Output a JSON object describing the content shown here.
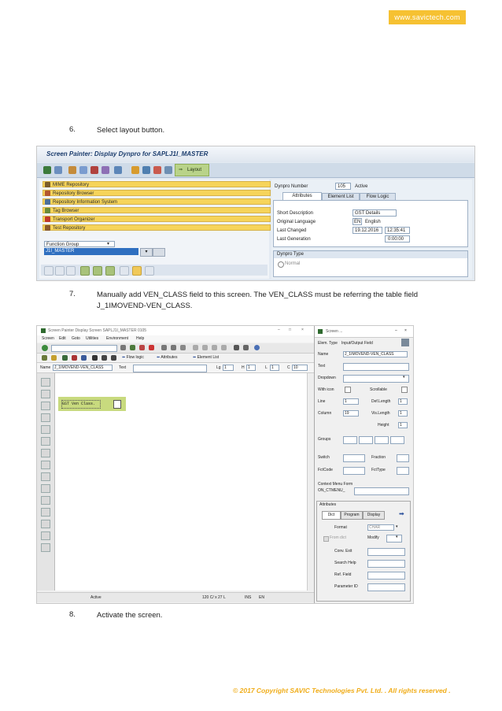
{
  "header": {
    "website": "www.savictech.com"
  },
  "steps": [
    {
      "num": "6.",
      "text": "Select layout button."
    },
    {
      "num": "7.",
      "text": "Manually add VEN_CLASS field to this screen. The VEN_CLASS must be referring the table field J_1IMOVEND-VEN_CLASS."
    },
    {
      "num": "8.",
      "text": "Activate the screen."
    }
  ],
  "shot1": {
    "title": "Screen Painter: Display Dynpro for SAPLJ1I_MASTER",
    "layout_btn": "Layout",
    "nav_items": [
      "MIME Repository",
      "Repository Browser",
      "Repository Information System",
      "Tag Browser",
      "Transport Organizer",
      "Test Repository"
    ],
    "object_type": "Function Group",
    "object_name": "J1I_MASTER",
    "dynpro_label": "Dynpro Number",
    "dynpro_number": "105",
    "dynpro_status": "Active",
    "tabs": [
      "Attributes",
      "Element List",
      "Flow Logic"
    ],
    "attr_labels": [
      "Short Description",
      "Original Language",
      "Last Changed",
      "Last Generation"
    ],
    "short_desc": "GST Details",
    "lang_code": "EN",
    "lang_name": "English",
    "last_changed_date": "19.12.2016",
    "last_changed_time": "12:35:41",
    "last_gen_time": "0:00:00",
    "dynpro_type_label": "Dynpro Type",
    "normal_label": "Normal"
  },
  "shot2": {
    "title": "Screen Painter   Display Screen SAPLJ1I_MASTER 0105",
    "menu": [
      "Screen",
      "Edit",
      "Goto",
      "Utilities",
      "Environment",
      "Help"
    ],
    "app_toolbar": [
      "Flow logic",
      "Attributes",
      "Element List"
    ],
    "name_label": "Name",
    "name_value": "J_1IMOVEND-VEN_CLASS",
    "text_label": "Text",
    "lg_label": "Lg",
    "lg_value": "1",
    "h_label": "H",
    "h_value": "1",
    "l_label": "L",
    "l_value": "1",
    "c_label": "C",
    "c_value": "10",
    "canvas_label": "GST Ven Class.",
    "status_text": "Active",
    "status_pos": "120 C/ x 27 L",
    "status_ins": "INS",
    "status_lang": "EN",
    "props_title": "Screen ...",
    "elem_type_label": "Elem. Type",
    "elem_type_value": "Input/Output Field",
    "prop_name_label": "Name",
    "prop_name_value": "J_1IMOVEND-VEN_CLASS",
    "prop_labels": [
      "Text",
      "Dropdown",
      "With icon",
      "Line",
      "Column",
      "Groups",
      "Switch",
      "FctCode",
      "Context Menu Form",
      "ON_CTMENU_"
    ],
    "scrollable_label": "Scrollable",
    "def_length_label": "Def.Length",
    "vis_length_label": "Vis.Length",
    "height_label": "Height",
    "line_value": "1",
    "column_value": "19",
    "def_length_value": "1",
    "vis_length_value": "1",
    "height_value": "1",
    "ftype_label": "FctType",
    "fraction_label": "Fraction",
    "attributes_label": "Attributes",
    "attr_tabs": [
      "Dict",
      "Program",
      "Display"
    ],
    "format_label": "Format",
    "format_value": "CHAR",
    "from_dict_label": "From dict",
    "modify_label": "Modify",
    "attr_rows": [
      "Conv. Exit",
      "Search Help",
      "Ref. Field",
      "Parameter ID"
    ]
  },
  "footer": {
    "copyright": "© 2017 Copyright SAVIC Technologies Pvt. Ltd. . All rights reserved ."
  }
}
